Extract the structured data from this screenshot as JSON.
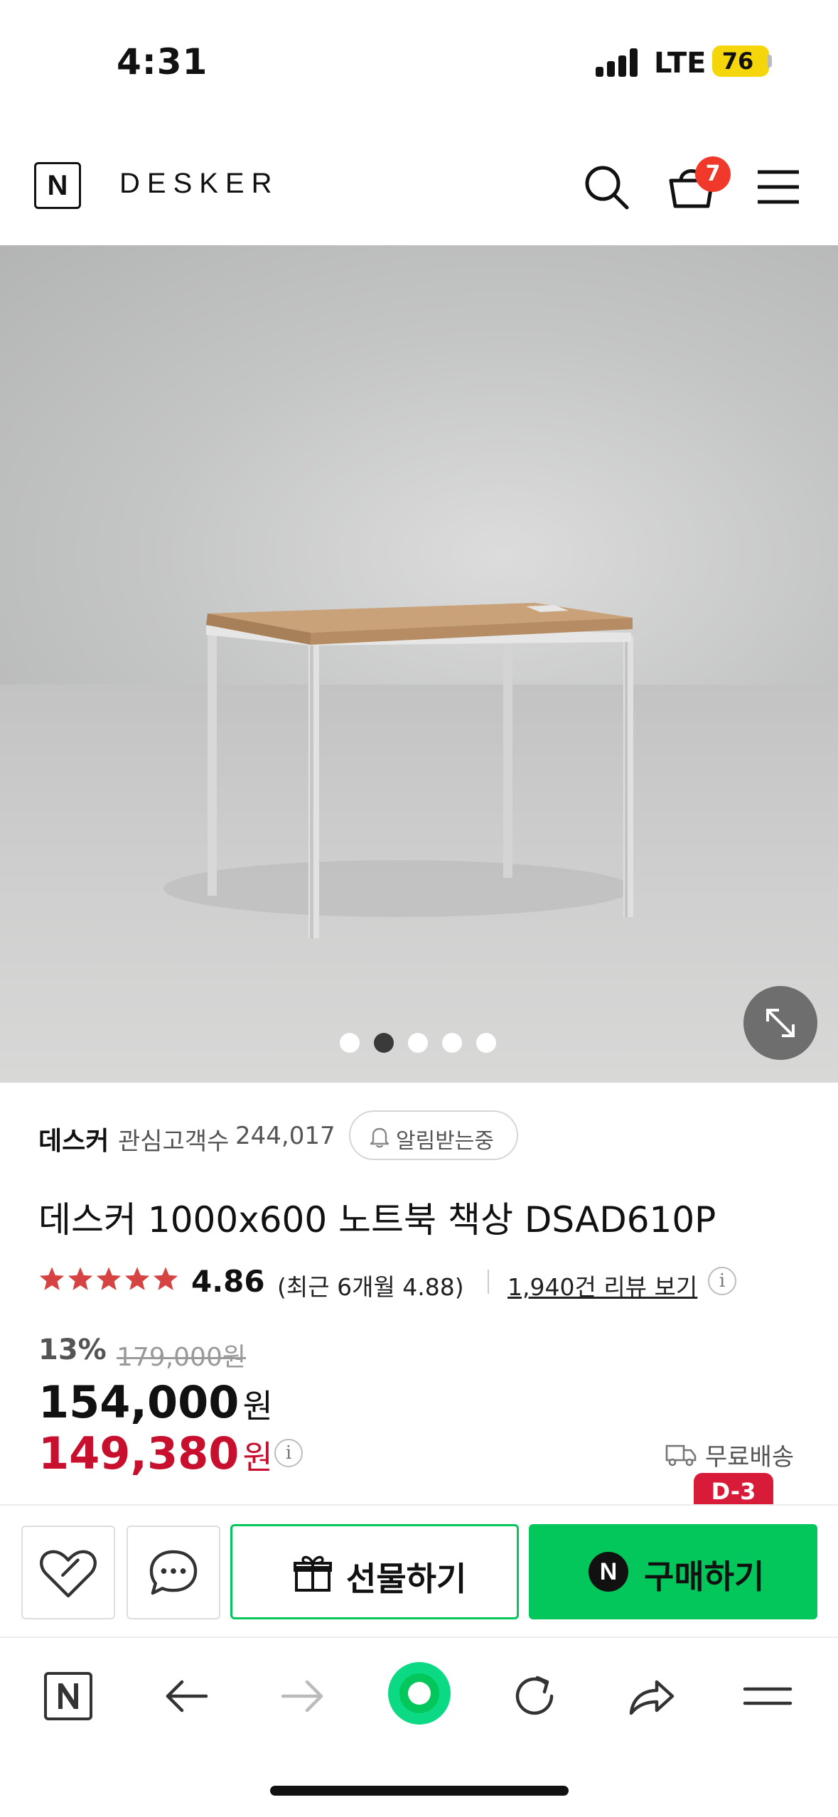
{
  "status_bar": {
    "time": "4:31",
    "network": "LTE",
    "battery": "76"
  },
  "header": {
    "logo_letter": "N",
    "brand": "DESKER",
    "cart_count": "7"
  },
  "gallery": {
    "total_images": 5,
    "active_index": 1
  },
  "product": {
    "seller": "데스커",
    "followers_label": "관심고객수",
    "followers_count": "244,017",
    "alert_label": "알림받는중",
    "title": "데스커 1000x600 노트북 책상 DSAD610P",
    "rating": "4.86",
    "rating_stars": 5,
    "rating_recent": "(최근 6개월 4.88)",
    "review_link": "1,940건 리뷰 보기",
    "discount_percent": "13%",
    "original_price": "179,000원",
    "price": "154,000",
    "price_unit": "원",
    "benefit_price": "149,380",
    "benefit_unit": "원",
    "shipping": "무료배송",
    "delivery_badge": "D-3"
  },
  "actions": {
    "gift_label": "선물하기",
    "buy_label": "구매하기",
    "buy_logo": "N"
  },
  "browser_bar": {
    "logo_letter": "N"
  },
  "colors": {
    "naver_green": "#03c75a",
    "sale_red": "#c8102e",
    "badge_red": "#f0392b",
    "battery_yellow": "#f5d60a"
  }
}
